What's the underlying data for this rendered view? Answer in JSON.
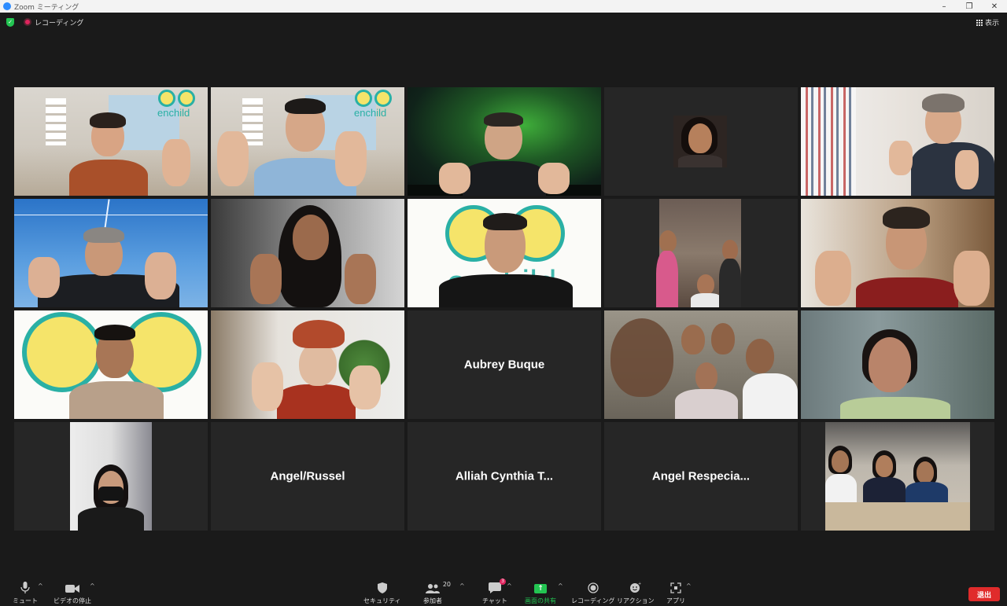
{
  "window": {
    "title": "Zoom ミーティング",
    "controls": [
      "–",
      "❐",
      "✕"
    ]
  },
  "status": {
    "recording_label": "レコーディング",
    "view_label": "表示"
  },
  "participants": [
    {
      "type": "video",
      "speaking": true
    },
    {
      "type": "video"
    },
    {
      "type": "video"
    },
    {
      "type": "video"
    },
    {
      "type": "video"
    },
    {
      "type": "video"
    },
    {
      "type": "video"
    },
    {
      "type": "video"
    },
    {
      "type": "video"
    },
    {
      "type": "video"
    },
    {
      "type": "video"
    },
    {
      "type": "video"
    },
    {
      "type": "name",
      "name": "Aubrey Buque"
    },
    {
      "type": "video"
    },
    {
      "type": "video"
    },
    {
      "type": "video"
    },
    {
      "type": "name",
      "name": "Angel/Russel"
    },
    {
      "type": "name",
      "name": "Alliah Cynthia T..."
    },
    {
      "type": "name",
      "name": "Angel  Respecia..."
    },
    {
      "type": "video"
    }
  ],
  "logo_text": "enchild",
  "toolbar": {
    "mute_label": "ミュート",
    "video_label": "ビデオの停止",
    "security_label": "セキュリティ",
    "participants_label": "参加者",
    "participants_count": "20",
    "chat_label": "チャット",
    "chat_badge": "3",
    "share_label": "画面の共有",
    "recording_label": "レコーディング",
    "reactions_label": "リアクション",
    "apps_label": "アプリ",
    "leave_label": "退出"
  },
  "colors": {
    "accent_green": "#23c552",
    "speaking_border": "#e8e36a",
    "leave_red": "#e02b2b",
    "logo_teal": "#2ab0a5",
    "logo_yellow": "#f5e46a"
  }
}
